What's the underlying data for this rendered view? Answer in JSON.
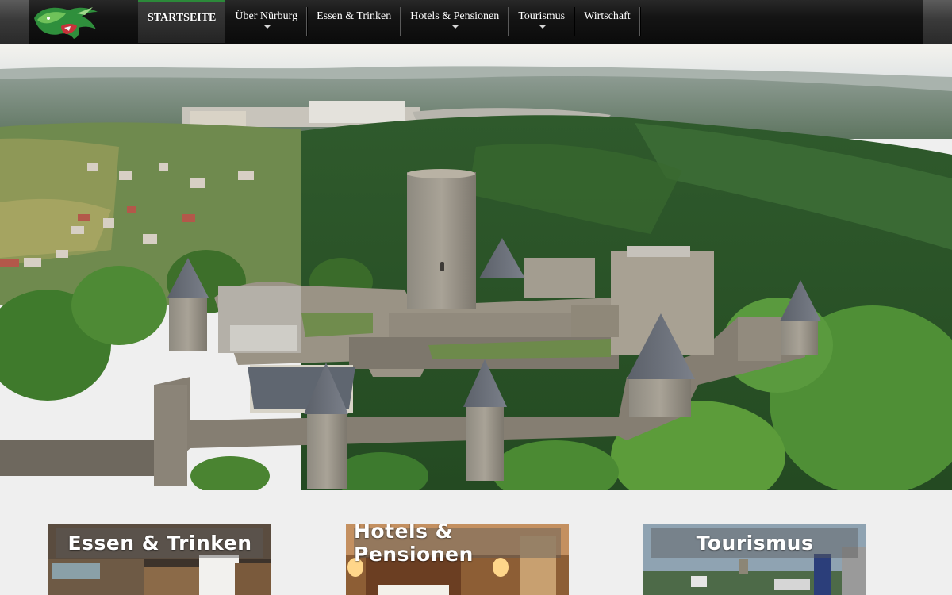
{
  "nav": {
    "items": [
      {
        "label": "STARTSEITE",
        "active": true,
        "dropdown": false
      },
      {
        "label": "Über Nürburg",
        "active": false,
        "dropdown": true
      },
      {
        "label": "Essen & Trinken",
        "active": false,
        "dropdown": false
      },
      {
        "label": "Hotels & Pensionen",
        "active": false,
        "dropdown": true
      },
      {
        "label": "Tourismus",
        "active": false,
        "dropdown": true
      },
      {
        "label": "Wirtschaft",
        "active": false,
        "dropdown": false
      }
    ]
  },
  "cards": [
    {
      "title": "Essen & Trinken"
    },
    {
      "title": "Hotels & Pensionen"
    },
    {
      "title": "Tourismus"
    }
  ],
  "colors": {
    "nav_active_accent": "#2c8a3a",
    "header_bg": "#141414",
    "page_bg": "#efefef"
  },
  "icons": {
    "logo": "green-dragon-logo",
    "dropdown": "caret-down-icon"
  }
}
